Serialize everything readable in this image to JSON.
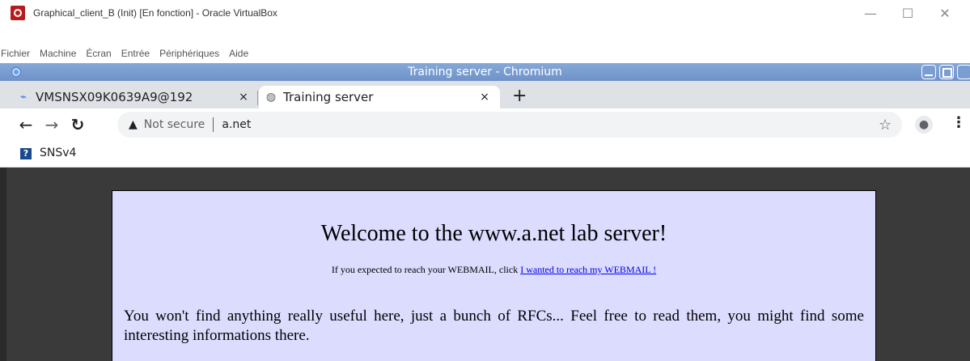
{
  "host_window": {
    "title": "Graphical_client_B (Init) [En fonction] - Oracle VirtualBox",
    "controls": {
      "minimize": "—",
      "maximize": "☐",
      "close": "✕"
    },
    "menu": [
      "Fichier",
      "Machine",
      "Écran",
      "Entrée",
      "Périphériques",
      "Aide"
    ]
  },
  "browser": {
    "window_title": "Training server - Chromium",
    "tabs": [
      {
        "label": "VMSNSX09K0639A9@192",
        "icon": "activity-icon",
        "active": false
      },
      {
        "label": "Training server",
        "icon": "globe-icon",
        "active": true
      }
    ],
    "tab_close": "×",
    "new_tab": "+",
    "address": {
      "security_label": "Not secure",
      "url": "a.net"
    },
    "bookmarks": [
      {
        "label": "SNSv4",
        "icon": "question-icon"
      }
    ]
  },
  "page": {
    "heading": "Welcome to the www.a.net lab server!",
    "subtext": "If you expected to reach your WEBMAIL, click",
    "webmail_link": "I wanted to reach my WEBMAIL !",
    "paragraph": "You won't find anything really useful here, just a bunch of RFCs... Feel free to read them, you might find some interesting informations there."
  }
}
